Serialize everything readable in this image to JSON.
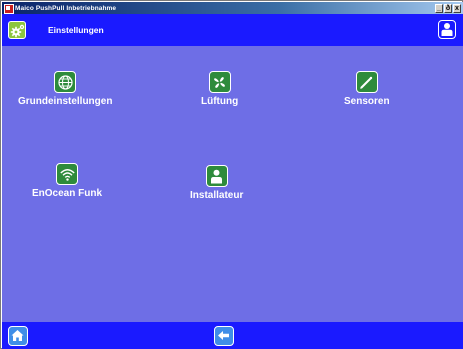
{
  "window": {
    "title": "Maico PushPull Inbetriebnahme",
    "minimize": "_",
    "maximize": "ð",
    "close": "x"
  },
  "header": {
    "title": "Einstellungen",
    "settings_icon": "gears-icon",
    "user_icon": "user-icon"
  },
  "tiles": [
    {
      "label": "Grundeinstellungen",
      "icon": "globe-icon"
    },
    {
      "label": "Lüftung",
      "icon": "fan-icon"
    },
    {
      "label": "Sensoren",
      "icon": "probe-icon"
    },
    {
      "label": "EnOcean Funk",
      "icon": "wireless-icon"
    },
    {
      "label": "Installateur",
      "icon": "installer-icon"
    }
  ],
  "footer": {
    "home_icon": "home-icon",
    "back_icon": "arrow-left-icon"
  },
  "colors": {
    "header_bg": "#1a1aff",
    "content_bg": "#6e6ee6",
    "tile_icon_bg": "#2e8b3c",
    "nav_button_bg": "#3f8ee8"
  }
}
